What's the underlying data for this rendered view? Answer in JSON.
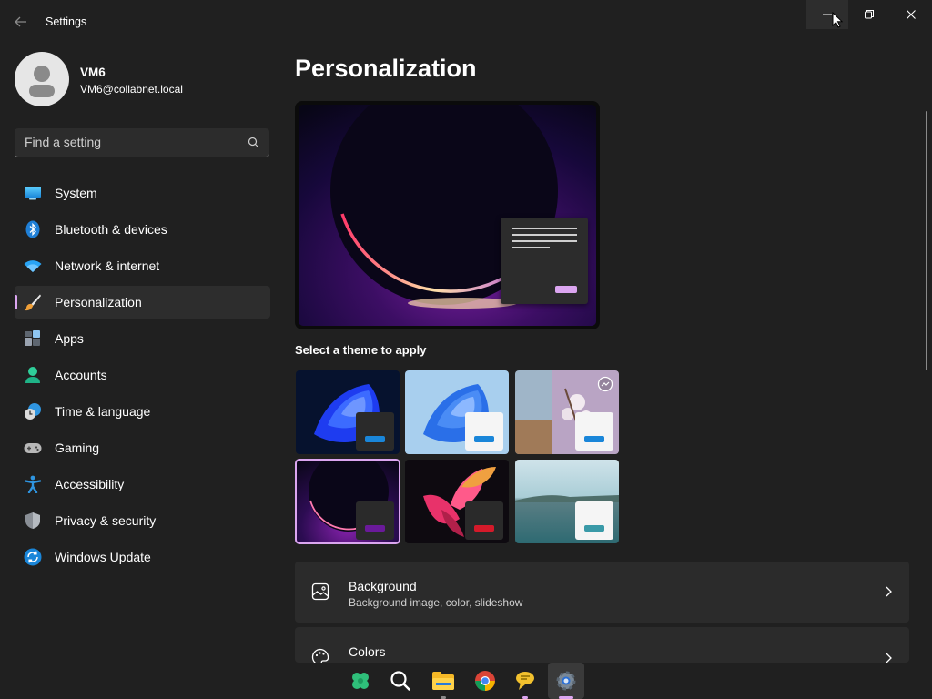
{
  "window": {
    "title": "Settings",
    "back_icon": "back-arrow-icon",
    "controls": [
      "minimize-icon",
      "restore-icon",
      "close-icon"
    ]
  },
  "profile": {
    "name": "VM6",
    "email": "VM6@collabnet.local"
  },
  "search": {
    "placeholder": "Find a setting",
    "value": ""
  },
  "nav": {
    "items": [
      {
        "label": "System",
        "icon": "display-icon"
      },
      {
        "label": "Bluetooth & devices",
        "icon": "bluetooth-icon"
      },
      {
        "label": "Network & internet",
        "icon": "wifi-icon"
      },
      {
        "label": "Personalization",
        "icon": "brush-icon",
        "active": true
      },
      {
        "label": "Apps",
        "icon": "apps-icon"
      },
      {
        "label": "Accounts",
        "icon": "person-icon"
      },
      {
        "label": "Time & language",
        "icon": "clock-globe-icon"
      },
      {
        "label": "Gaming",
        "icon": "gamepad-icon"
      },
      {
        "label": "Accessibility",
        "icon": "accessibility-icon"
      },
      {
        "label": "Privacy & security",
        "icon": "shield-icon"
      },
      {
        "label": "Windows Update",
        "icon": "update-icon"
      }
    ]
  },
  "main": {
    "title": "Personalization",
    "themes_label": "Select a theme to apply",
    "themes": [
      {
        "name": "windows-dark",
        "selected": false
      },
      {
        "name": "windows-light",
        "selected": false
      },
      {
        "name": "windows-spotlight",
        "selected": false
      },
      {
        "name": "glow",
        "selected": true
      },
      {
        "name": "captured-motion",
        "selected": false
      },
      {
        "name": "flow",
        "selected": false
      }
    ],
    "cards": [
      {
        "title": "Background",
        "subtitle": "Background image, color, slideshow",
        "icon": "image-icon"
      },
      {
        "title": "Colors",
        "subtitle": "",
        "icon": "palette-icon"
      }
    ]
  },
  "taskbar": {
    "items": [
      "start-icon",
      "search-icon",
      "file-explorer-icon",
      "chrome-icon",
      "chat-icon",
      "settings-icon"
    ],
    "active": "settings-icon"
  },
  "colors": {
    "accent": "#dba5f0",
    "background": "#202020",
    "card": "#2b2b2b"
  }
}
